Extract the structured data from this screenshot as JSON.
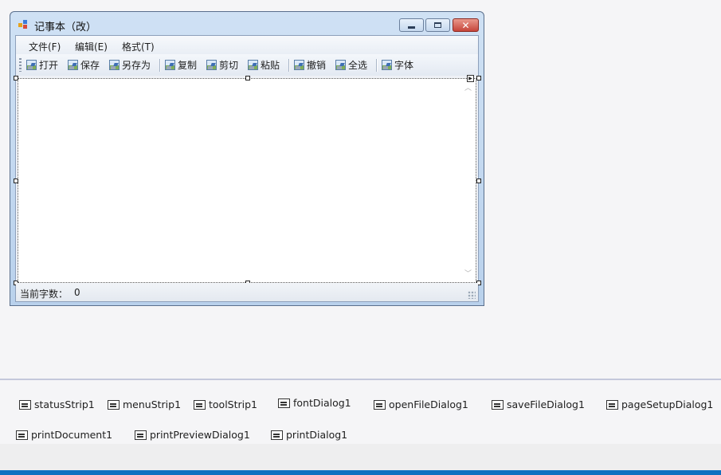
{
  "window": {
    "title": "记事本（改）"
  },
  "menu": [
    "文件(F)",
    "编辑(E)",
    "格式(T)"
  ],
  "toolbar": {
    "buttons": [
      {
        "label": "打开",
        "icon": "picture-icon"
      },
      {
        "label": "保存",
        "icon": "picture-icon"
      },
      {
        "label": "另存为",
        "icon": "picture-icon"
      },
      {
        "label": "复制",
        "icon": "picture-icon"
      },
      {
        "label": "剪切",
        "icon": "picture-icon"
      },
      {
        "label": "粘贴",
        "icon": "picture-icon"
      },
      {
        "label": "撤销",
        "icon": "picture-icon"
      },
      {
        "label": "全选",
        "icon": "picture-icon"
      },
      {
        "label": "字体",
        "icon": "picture-icon"
      }
    ]
  },
  "status": {
    "label": "当前字数：",
    "value": "0"
  },
  "tray": {
    "row1": [
      "statusStrip1",
      "menuStrip1",
      "toolStrip1",
      "fontDialog1",
      "openFileDialog1",
      "saveFileDialog1",
      "pageSetupDialog1"
    ],
    "row2": [
      "printDocument1",
      "printPreviewDialog1",
      "printDialog1"
    ]
  },
  "colors": {
    "accent_blue": "#0e70c0",
    "close_red": "#c6453a"
  }
}
